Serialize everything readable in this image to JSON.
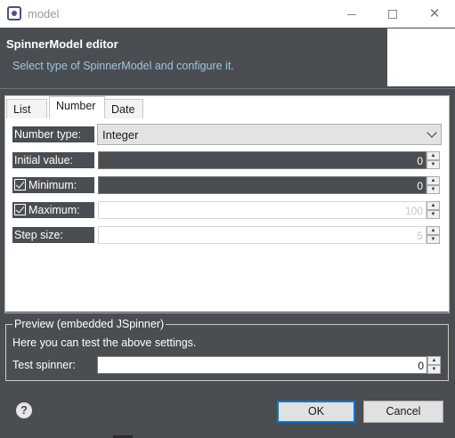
{
  "window": {
    "title": "model",
    "icon": "eclipse-app-icon"
  },
  "header": {
    "title": "SpinnerModel editor",
    "subtitle": "Select type of SpinnerModel and configure it."
  },
  "tabs": [
    {
      "label": "List",
      "active": false
    },
    {
      "label": "Number",
      "active": true
    },
    {
      "label": "Date",
      "active": false
    }
  ],
  "form": {
    "number_type": {
      "label": "Number type:",
      "value": "Integer"
    },
    "initial_value": {
      "label": "Initial value:",
      "value": "0"
    },
    "minimum": {
      "label": "Minimum:",
      "checked": true,
      "value": "0"
    },
    "maximum": {
      "label": "Maximum:",
      "checked": true,
      "value": "100"
    },
    "step_size": {
      "label": "Step size:",
      "value": "5"
    }
  },
  "preview": {
    "legend": "Preview (embedded JSpinner)",
    "description": "Here you can test the above settings.",
    "test_label": "Test spinner:",
    "test_value": "0"
  },
  "buttons": {
    "help": "?",
    "ok": "OK",
    "cancel": "Cancel"
  },
  "colors": {
    "background": "#4a4e52",
    "subtitle": "#9ec6e0",
    "default_button_border": "#0078d7"
  }
}
